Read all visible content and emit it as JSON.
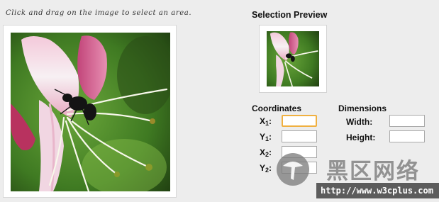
{
  "instruction": "Click and drag on the image to select an area.",
  "main_image": {
    "alt": "honeysuckle flower with ant"
  },
  "preview": {
    "title": "Selection Preview"
  },
  "coordinates": {
    "title": "Coordinates",
    "fields": [
      {
        "label": "X",
        "sub": "1",
        "value": ""
      },
      {
        "label": "Y",
        "sub": "1",
        "value": ""
      },
      {
        "label": "X",
        "sub": "2",
        "value": ""
      },
      {
        "label": "Y",
        "sub": "2",
        "value": ""
      }
    ]
  },
  "dimensions": {
    "title": "Dimensions",
    "width_label": "Width:",
    "width_value": "",
    "height_label": "Height:",
    "height_value": ""
  },
  "watermark": {
    "text": "黑区网络",
    "url": "http://www.w3cplus.com"
  },
  "colors": {
    "background": "#ededed",
    "focus_border": "#f0b040"
  }
}
